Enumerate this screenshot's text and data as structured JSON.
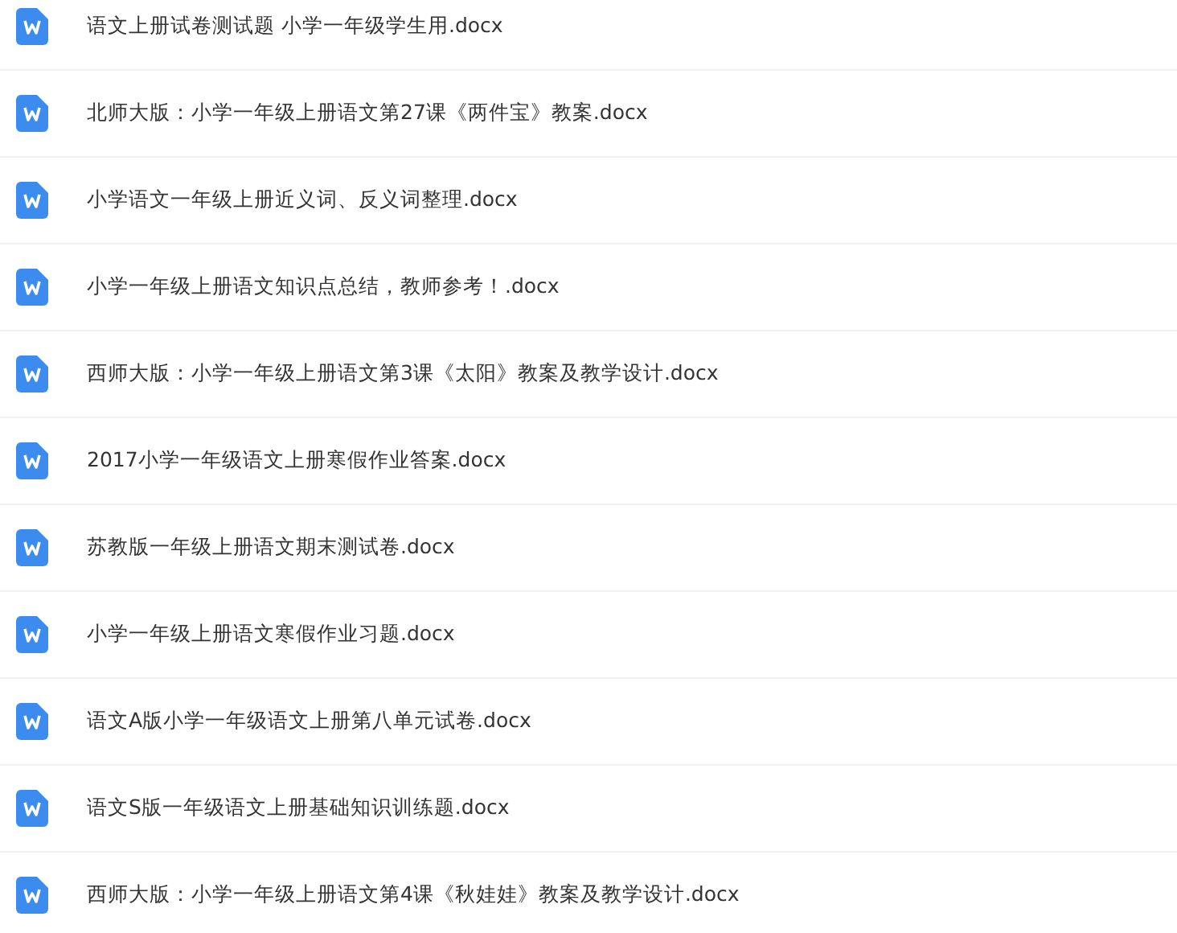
{
  "files": [
    {
      "name": "语文上册试卷测试题 小学一年级学生用.docx",
      "kind": "word"
    },
    {
      "name": "北师大版：小学一年级上册语文第27课《两件宝》教案.docx",
      "kind": "word"
    },
    {
      "name": "小学语文一年级上册近义词、反义词整理.docx",
      "kind": "word"
    },
    {
      "name": "小学一年级上册语文知识点总结，教师参考！.docx",
      "kind": "word"
    },
    {
      "name": "西师大版：小学一年级上册语文第3课《太阳》教案及教学设计.docx",
      "kind": "word"
    },
    {
      "name": "2017小学一年级语文上册寒假作业答案.docx",
      "kind": "word"
    },
    {
      "name": "苏教版一年级上册语文期末测试卷.docx",
      "kind": "word"
    },
    {
      "name": "小学一年级上册语文寒假作业习题.docx",
      "kind": "word"
    },
    {
      "name": "语文A版小学一年级语文上册第八单元试卷.docx",
      "kind": "word"
    },
    {
      "name": "语文S版一年级语文上册基础知识训练题.docx",
      "kind": "word"
    },
    {
      "name": "西师大版：小学一年级上册语文第4课《秋娃娃》教案及教学设计.docx",
      "kind": "word"
    }
  ]
}
